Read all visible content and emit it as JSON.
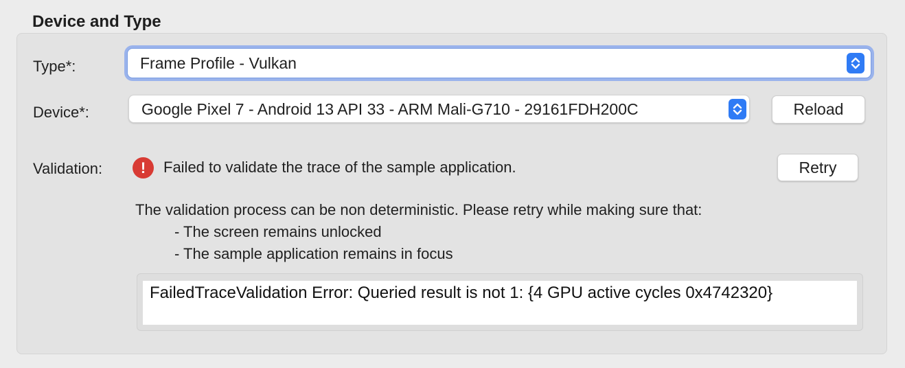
{
  "section": {
    "title": "Device and Type"
  },
  "type_field": {
    "label": "Type*:",
    "selected": "Frame Profile - Vulkan"
  },
  "device_field": {
    "label": "Device*:",
    "selected": "Google Pixel 7 - Android 13 API 33 - ARM Mali-G710 - 29161FDH200C",
    "reload_label": "Reload"
  },
  "validation": {
    "label": "Validation:",
    "status_icon": "error-icon",
    "message": "Failed to validate the trace of the sample application.",
    "retry_label": "Retry",
    "hint_intro": "The validation process can be non deterministic. Please retry while making sure that:",
    "hint_items": [
      "- The screen remains unlocked",
      "- The sample application remains in focus"
    ],
    "error_detail": "FailedTraceValidation Error: Queried result is not 1: {4 GPU active cycles 0x4742320}"
  },
  "colors": {
    "accent": "#2f7bf5",
    "error": "#d83b34",
    "focus_ring": "#9ab3ec"
  }
}
